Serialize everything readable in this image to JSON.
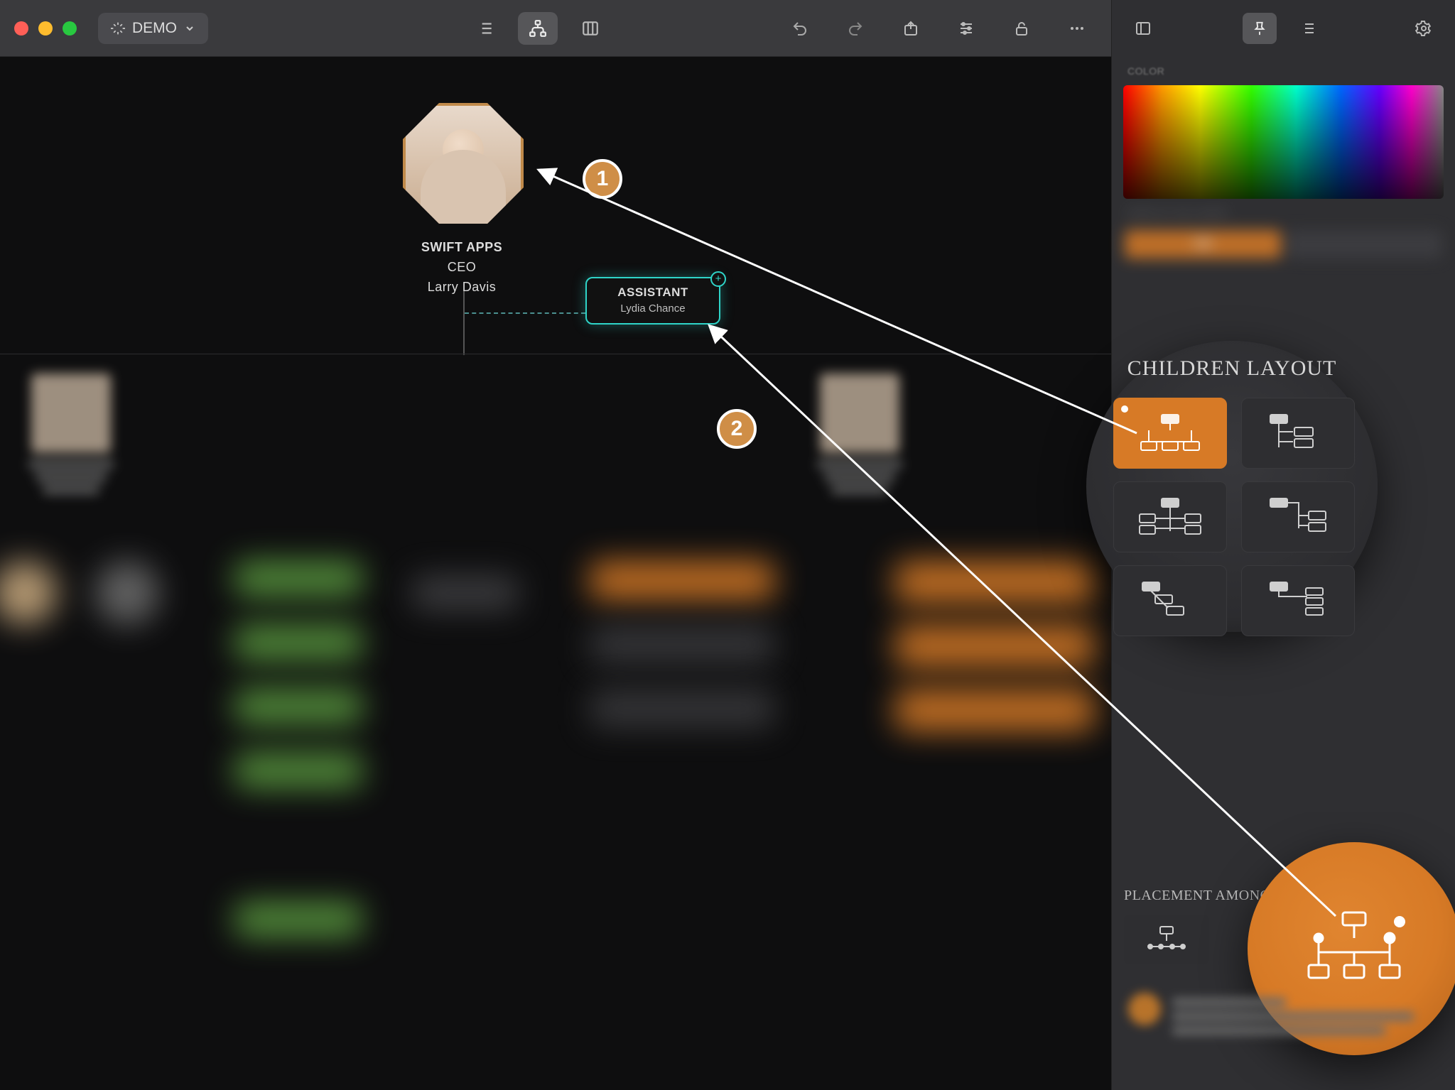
{
  "toolbar": {
    "project_label": "DEMO",
    "icons": {
      "sparkle": "sparkle-icon",
      "chevron_down": "chevron-down-icon",
      "list": "list-icon",
      "orgchart": "orgchart-icon",
      "columns": "columns-icon",
      "undo": "undo-icon",
      "redo": "redo-icon",
      "share": "share-icon",
      "sliders": "sliders-icon",
      "lock": "unlock-icon",
      "more": "more-icon"
    }
  },
  "sidebar_top": {
    "icons": {
      "panel": "panel-toggle-icon",
      "pin": "pin-icon",
      "list": "list-icon",
      "settings": "gear-icon"
    }
  },
  "colors": {
    "accent_orange": "#d77a26",
    "assistant_teal": "#2fd4c8",
    "callout_fill": "#cf8e47"
  },
  "ceo": {
    "company": "SWIFT APPS",
    "title": "CEO",
    "name": "Larry Davis"
  },
  "assistant": {
    "title": "ASSISTANT",
    "name": "Lydia Chance",
    "plus": "+"
  },
  "callouts": {
    "one": "1",
    "two": "2"
  },
  "inspector": {
    "color_label": "COLOR",
    "display_label": "DISPLAY ON CHART",
    "display_value": "ON",
    "children_layout_label": "CHILDREN LAYOUT",
    "placement_label": "PLACEMENT AMONG SIBLINGS",
    "children_layout_options": [
      "tree-balanced",
      "tree-right-stack",
      "tree-both-stack",
      "tree-right-indent",
      "tree-staircase-left",
      "tree-staircase-right"
    ],
    "children_layout_selected": "tree-balanced",
    "placement_options": [
      "siblings-inline",
      "siblings-centered"
    ],
    "placement_selected": "siblings-centered"
  }
}
